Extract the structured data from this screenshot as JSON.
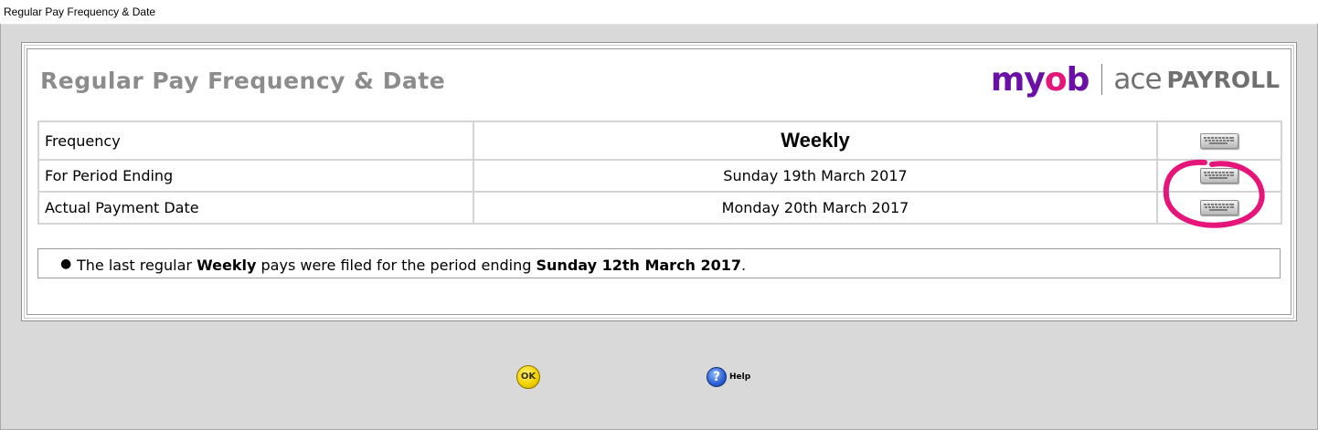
{
  "window": {
    "title": "Regular Pay Frequency & Date"
  },
  "header": {
    "heading": "Regular Pay Frequency & Date",
    "logo": {
      "myob_prefix": "my",
      "myob_o": "o",
      "myob_b": "b",
      "ace": "ace",
      "payroll": "PAYROLL"
    }
  },
  "rows": [
    {
      "label": "Frequency",
      "value": "Weekly"
    },
    {
      "label": "For Period Ending",
      "value": "Sunday 19th March 2017"
    },
    {
      "label": "Actual Payment Date",
      "value": "Monday 20th March 2017"
    }
  ],
  "note": {
    "part1": "The last regular ",
    "frequency": "Weekly",
    "part2": " pays were filed for the period ending ",
    "date": "Sunday 12th March 2017",
    "part3": "."
  },
  "buttons": {
    "ok_label": "OK",
    "help_glyph": "?",
    "help_label": "Help"
  },
  "icons": {
    "row_buttons": "keyboard-icon",
    "ok": "ok-icon",
    "help": "help-icon"
  },
  "colors": {
    "annotation": "#e6157a",
    "brand_purple": "#6b0fa6",
    "brand_grey": "#707070"
  }
}
